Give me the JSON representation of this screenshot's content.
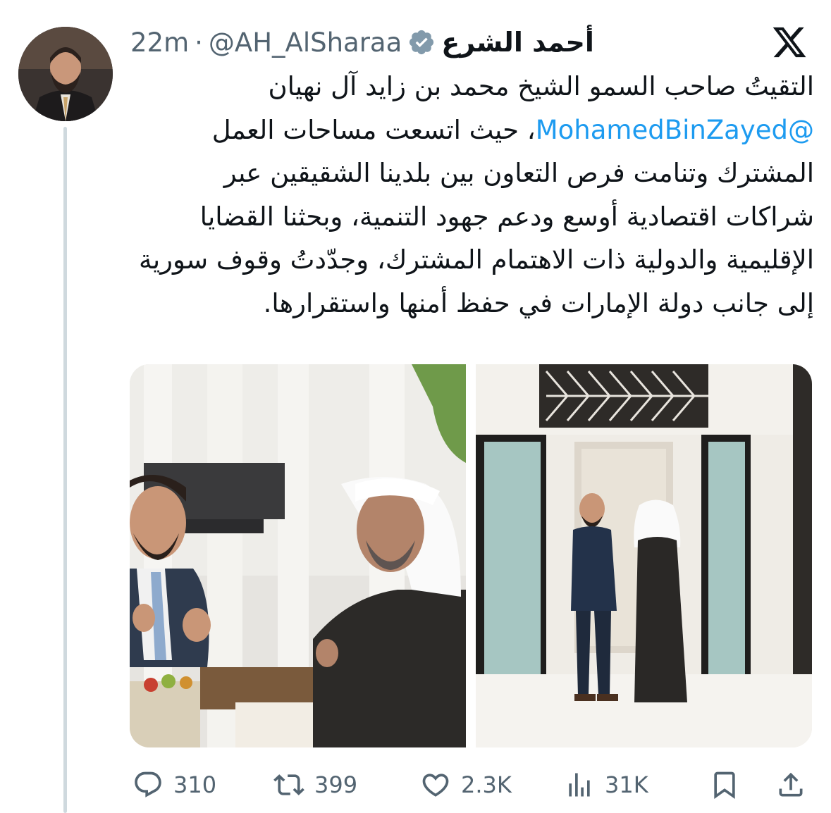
{
  "author": {
    "display_name": "أحمد الشرع",
    "handle": "@AH_AlSharaa",
    "separator": "·",
    "time": "22m",
    "verified": true,
    "avatar_icon": "profile-photo"
  },
  "platform_icon": "x-logo-icon",
  "tweet": {
    "text_before_mention": "التقيتُ صاحب السمو الشيخ محمد بن زايد آل نهيان ",
    "mention": "@MohamedBinZayed",
    "text_after_mention": "، حيث اتسعت مساحات العمل المشترك وتنامت فرص التعاون بين بلدينا الشقيقين عبر شراكات اقتصادية أوسع ودعم جهود التنمية، وبحثنا القضايا الإقليمية والدولية ذات الاهتمام المشترك، وجدّدتُ وقوف سورية إلى جانب دولة الإمارات في حفظ أمنها واستقرارها."
  },
  "media": [
    {
      "icon": "photo-meeting-seated"
    },
    {
      "icon": "photo-meeting-doorway"
    }
  ],
  "actions": {
    "replies": "310",
    "reposts": "399",
    "likes": "2.3K",
    "views": "31K"
  },
  "colors": {
    "accent": "#1d9bf0",
    "secondary_text": "#536471",
    "verified_badge": "#829aab",
    "primary_text": "#0f1419"
  }
}
